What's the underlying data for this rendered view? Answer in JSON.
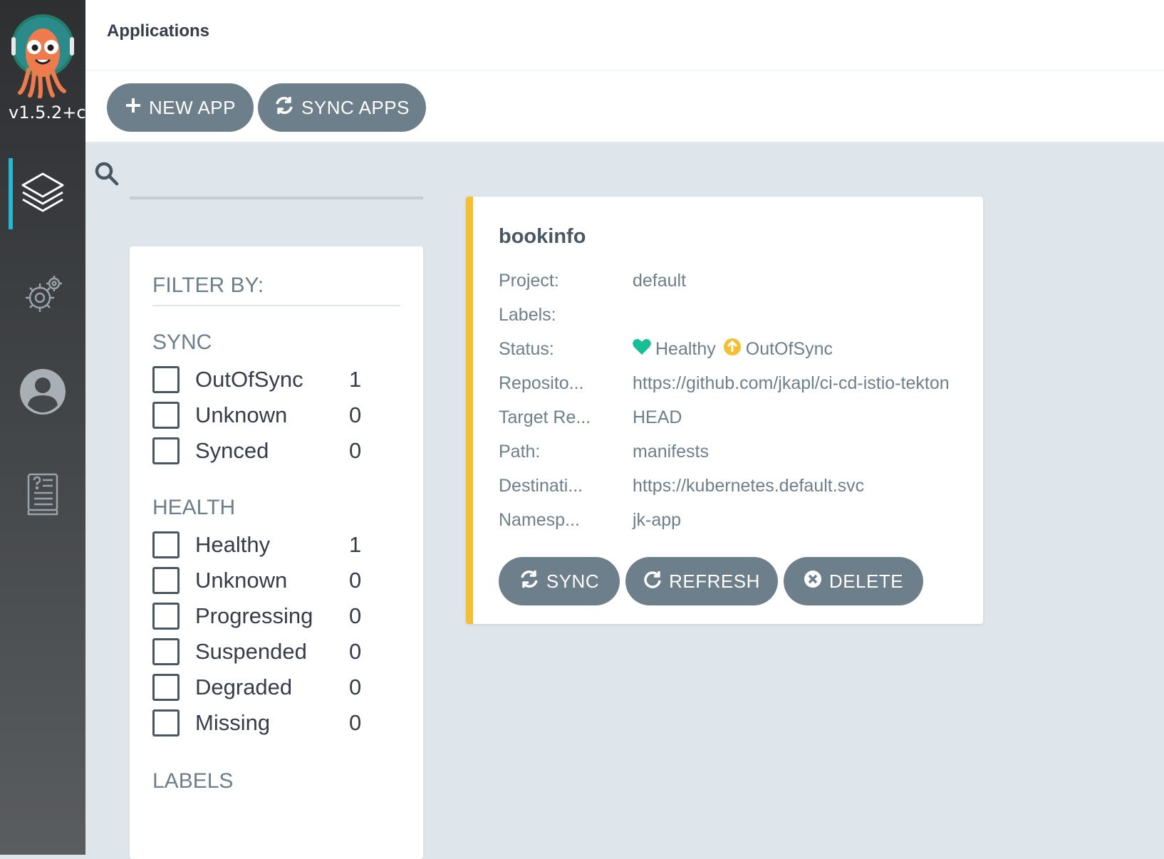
{
  "sidebar": {
    "version": "v1.5.2+c",
    "nav": [
      {
        "name": "applications",
        "icon": "layers-icon",
        "active": true
      },
      {
        "name": "settings",
        "icon": "gears-icon",
        "active": false
      },
      {
        "name": "user-info",
        "icon": "user-icon",
        "active": false
      },
      {
        "name": "documentation",
        "icon": "docs-icon",
        "active": false
      }
    ],
    "accent_color": "#25b9d1"
  },
  "header": {
    "title": "Applications"
  },
  "toolbar": {
    "new_app_label": "NEW APP",
    "sync_apps_label": "SYNC APPS"
  },
  "search": {
    "value": "",
    "placeholder": ""
  },
  "filters": {
    "title": "FILTER BY:",
    "sync": {
      "title": "SYNC",
      "items": [
        {
          "label": "OutOfSync",
          "count": "1"
        },
        {
          "label": "Unknown",
          "count": "0"
        },
        {
          "label": "Synced",
          "count": "0"
        }
      ]
    },
    "health": {
      "title": "HEALTH",
      "items": [
        {
          "label": "Healthy",
          "count": "1"
        },
        {
          "label": "Unknown",
          "count": "0"
        },
        {
          "label": "Progressing",
          "count": "0"
        },
        {
          "label": "Suspended",
          "count": "0"
        },
        {
          "label": "Degraded",
          "count": "0"
        },
        {
          "label": "Missing",
          "count": "0"
        }
      ]
    },
    "labels_title": "LABELS"
  },
  "app": {
    "name": "bookinfo",
    "status_color": "#f4c030",
    "fields": {
      "project": {
        "key": "Project:",
        "value": "default"
      },
      "labels": {
        "key": "Labels:",
        "value": ""
      },
      "status": {
        "key": "Status:",
        "health": "Healthy",
        "sync": "OutOfSync",
        "health_color": "#18be94",
        "sync_color": "#f4c030"
      },
      "repository": {
        "key": "Reposito...",
        "value": "https://github.com/jkapl/ci-cd-istio-tekton"
      },
      "target_revision": {
        "key": "Target Re...",
        "value": "HEAD"
      },
      "path": {
        "key": "Path:",
        "value": "manifests"
      },
      "destination": {
        "key": "Destinati...",
        "value": "https://kubernetes.default.svc"
      },
      "namespace": {
        "key": "Namesp...",
        "value": "jk-app"
      }
    },
    "actions": {
      "sync_label": "SYNC",
      "refresh_label": "REFRESH",
      "delete_label": "DELETE"
    }
  }
}
